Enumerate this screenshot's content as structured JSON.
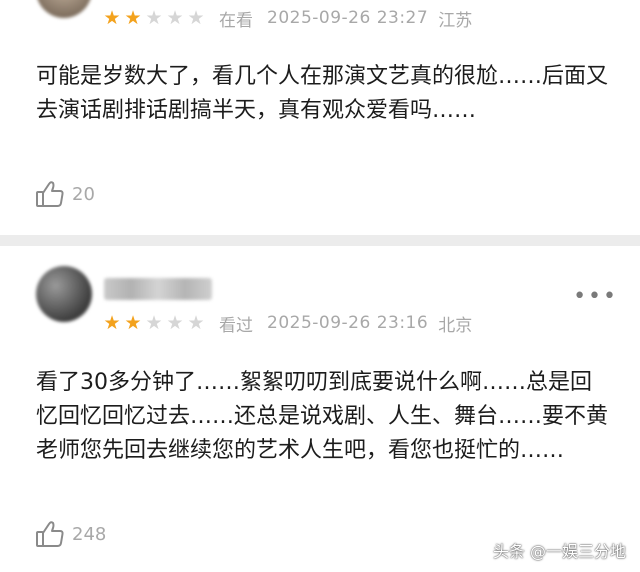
{
  "reviews": [
    {
      "rating": 2,
      "status": "在看",
      "datetime": "2025-09-26 23:27",
      "region": "江苏",
      "content": "可能是岁数大了，看几个人在那演文艺真的很尬……后面又去演话剧排话剧搞半天，真有观众爱看吗……",
      "likes": "20"
    },
    {
      "rating": 2,
      "status": "看过",
      "datetime": "2025-09-26 23:16",
      "region": "北京",
      "content": "看了30多分钟了……絮絮叨叨到底要说什么啊……总是回忆回忆回忆过去……还总是说戏剧、人生、舞台……要不黄老师您先回去继续您的艺术人生吧，看您也挺忙的……",
      "likes": "248",
      "more_label": "•••"
    }
  ],
  "watermark": "头条 @一娱三分地",
  "colors": {
    "star_on": "#f3a21d",
    "star_off": "#d6d6d6",
    "meta_text": "#a8a8a8"
  },
  "icons": {
    "star": "star-icon",
    "like": "thumbs-up-icon",
    "more": "more-icon"
  }
}
